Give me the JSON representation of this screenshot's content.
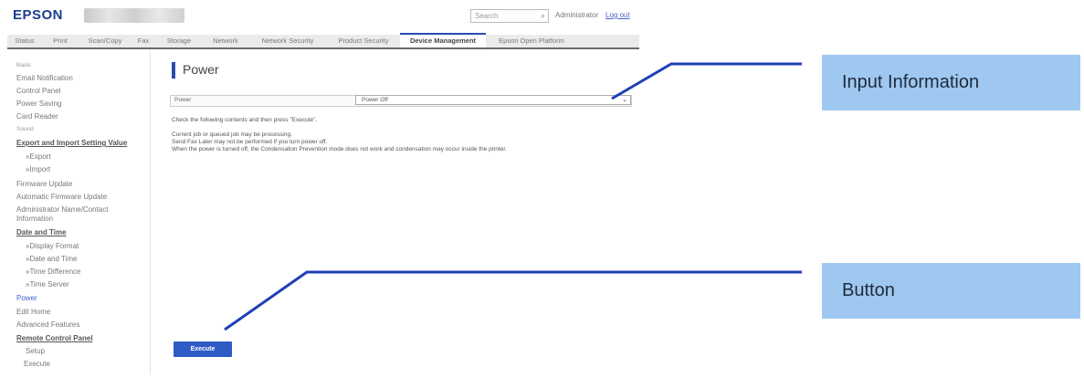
{
  "header": {
    "logo": "EPSON",
    "search_placeholder": "Search",
    "search_icon": "magnifier-icon",
    "admin_label": "Administrator",
    "logout_label": "Log out"
  },
  "tabs": [
    {
      "label": "Status"
    },
    {
      "label": "Print"
    },
    {
      "label": "Scan/Copy"
    },
    {
      "label": "Fax"
    },
    {
      "label": "Storage"
    },
    {
      "label": "Network"
    },
    {
      "label": "Network Security"
    },
    {
      "label": "Product Security"
    },
    {
      "label": "Device Management",
      "active": true
    },
    {
      "label": "Epson Open Platform"
    }
  ],
  "sidebar": {
    "items": [
      {
        "label": "Basic"
      },
      {
        "label": "Email Notification"
      },
      {
        "label": "Control Panel"
      },
      {
        "label": "Power Saving"
      },
      {
        "label": "Card Reader"
      },
      {
        "label": "Sound"
      },
      {
        "label": "Export and Import Setting Value"
      },
      {
        "label": "»Export"
      },
      {
        "label": "»Import"
      },
      {
        "label": "Firmware Update"
      },
      {
        "label": "Automatic Firmware Update"
      },
      {
        "label": "Administrator Name/Contact"
      },
      {
        "label": "Information"
      },
      {
        "label": "Date and Time"
      },
      {
        "label": "»Display Format"
      },
      {
        "label": "»Date and Time"
      },
      {
        "label": "»Time Difference"
      },
      {
        "label": "»Time Server"
      },
      {
        "label": "Power"
      },
      {
        "label": "Edit Home"
      },
      {
        "label": "Advanced Features"
      },
      {
        "label": "Remote Control Panel"
      },
      {
        "label": "Setup"
      },
      {
        "label": "Execute"
      }
    ]
  },
  "main": {
    "title": "Power",
    "field_label": "Power",
    "field_value": "Power Off",
    "instruction": "Check the following contents and then press \"Execute\".",
    "warnings": [
      "Current job or queued job may be processing.",
      "Send Fax Later may not be performed if you turn power off.",
      "When the power is turned off, the Condensation Prevention mode does not work and condensation may occur inside the printer."
    ],
    "execute_label": "Execute"
  },
  "annotations": {
    "input_information": "Input Information",
    "button": "Button",
    "line_color": "#1f3fb5",
    "callout_color": "#9fc8f1"
  }
}
